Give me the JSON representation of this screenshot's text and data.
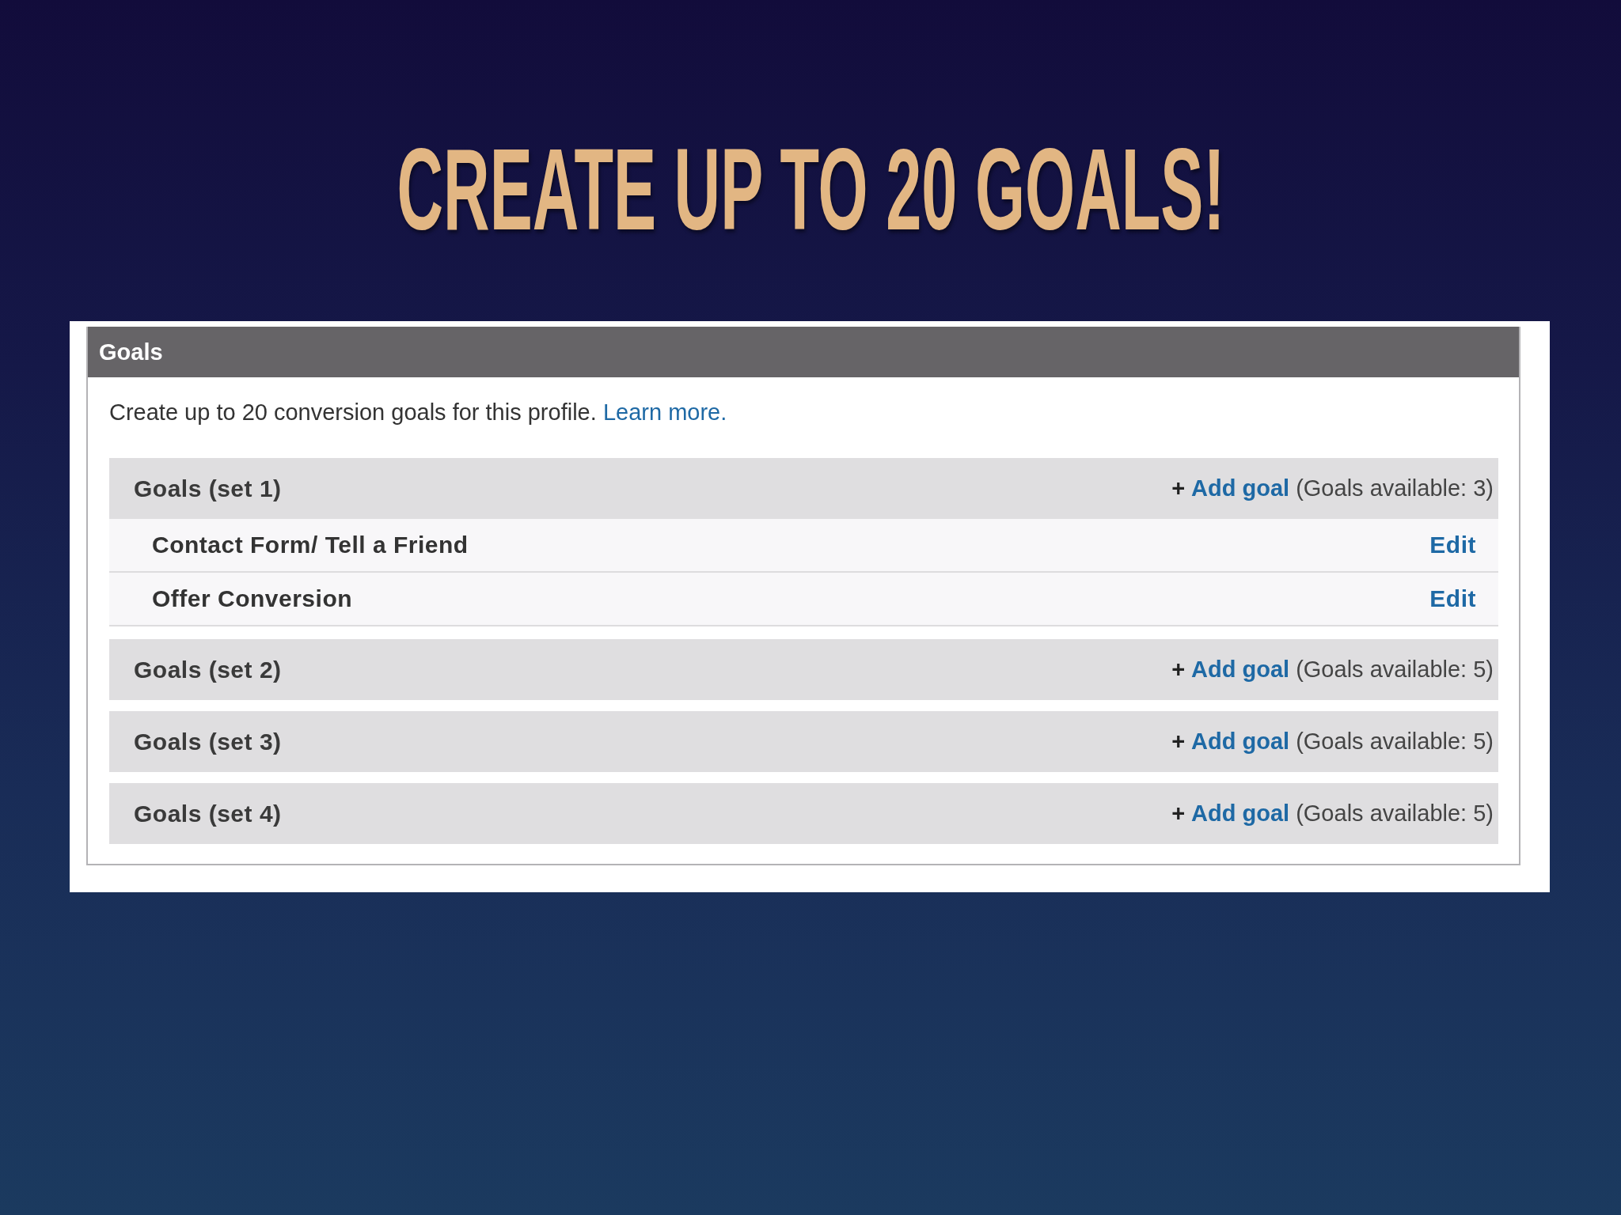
{
  "slide": {
    "title": "CREATE UP TO 20 GOALS!"
  },
  "panel": {
    "title": "Goals",
    "intro": "Create up to 20 conversion goals for this profile.",
    "intro_link": "Learn more.",
    "goal_sets": [
      {
        "title": "Goals (set 1)",
        "add_icon": "+",
        "add_link": "Add goal",
        "available": "(Goals available: 3)",
        "goals": [
          {
            "name": "Contact Form/ Tell a Friend",
            "action": "Edit"
          },
          {
            "name": "Offer Conversion",
            "action": "Edit"
          }
        ]
      },
      {
        "title": "Goals (set 2)",
        "add_icon": "+",
        "add_link": "Add goal",
        "available": "(Goals available: 5)"
      },
      {
        "title": "Goals (set 3)",
        "add_icon": "+",
        "add_link": "Add goal",
        "available": "(Goals available: 5)"
      },
      {
        "title": "Goals (set 4)",
        "add_icon": "+",
        "add_link": "Add goal",
        "available": "(Goals available: 5)"
      }
    ]
  }
}
